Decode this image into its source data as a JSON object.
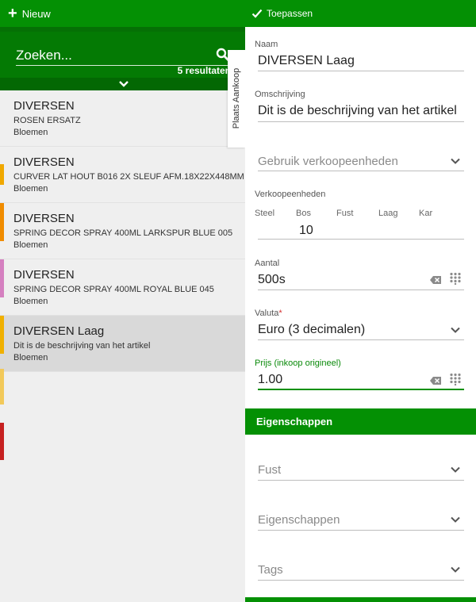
{
  "toolbar": {
    "new_label": "Nieuw",
    "apply_label": "Toepassen"
  },
  "search": {
    "placeholder": "Zoeken...",
    "results_count": "5 resultaten"
  },
  "side_tab": {
    "label": "Plaats Aankoop"
  },
  "list": {
    "items": [
      {
        "title": "DIVERSEN",
        "description": "ROSEN ERSATZ",
        "category": "Bloemen"
      },
      {
        "title": "DIVERSEN",
        "description": "CURVER LAT HOUT B016 2X SLEUF AFM.18X22X448MM",
        "category": "Bloemen"
      },
      {
        "title": "DIVERSEN",
        "description": "SPRING DECOR SPRAY 400ML LARKSPUR BLUE 005",
        "category": "Bloemen"
      },
      {
        "title": "DIVERSEN",
        "description": "SPRING DECOR SPRAY 400ML ROYAL BLUE 045",
        "category": "Bloemen"
      },
      {
        "title": "DIVERSEN Laag",
        "description": "Dit is de beschrijving van het artikel",
        "category": "Bloemen"
      }
    ],
    "stripe_colors": [
      "#f0a800",
      "#f08c00",
      "#d580c0",
      "#f0b000",
      "#f2c95a",
      "#c62020"
    ]
  },
  "form": {
    "naam": {
      "label": "Naam",
      "value": "DIVERSEN Laag"
    },
    "omschrijving": {
      "label": "Omschrijving",
      "value": "Dit is de beschrijving van het artikel"
    },
    "gebruik": {
      "placeholder": "Gebruik verkoopeenheden"
    },
    "verkoopeenheden": {
      "label": "Verkoopeenheden",
      "units": [
        "Steel",
        "Bos",
        "Fust",
        "Laag",
        "Kar"
      ],
      "bos_value": "10"
    },
    "aantal": {
      "label": "Aantal",
      "value": "500s"
    },
    "valuta": {
      "label": "Valuta",
      "required_mark": "*",
      "value": "Euro (3 decimalen)"
    },
    "prijs": {
      "label": "Prijs (inkoop origineel)",
      "value": "1.00"
    }
  },
  "properties": {
    "header": "Eigenschappen",
    "fust": {
      "placeholder": "Fust"
    },
    "eigenschappen": {
      "placeholder": "Eigenschappen"
    },
    "tags": {
      "placeholder": "Tags"
    }
  },
  "colors": {
    "brand_green": "#049004",
    "dark_green": "#047a04",
    "required_red": "#d32f2f",
    "active_label_green": "#0a8a0a"
  },
  "icons": {
    "plus": "plus-icon",
    "check": "check-icon",
    "search": "search-icon",
    "chevron": "chevron-down-icon",
    "clear": "backspace-clear-icon",
    "keypad": "keypad-grid-icon"
  }
}
